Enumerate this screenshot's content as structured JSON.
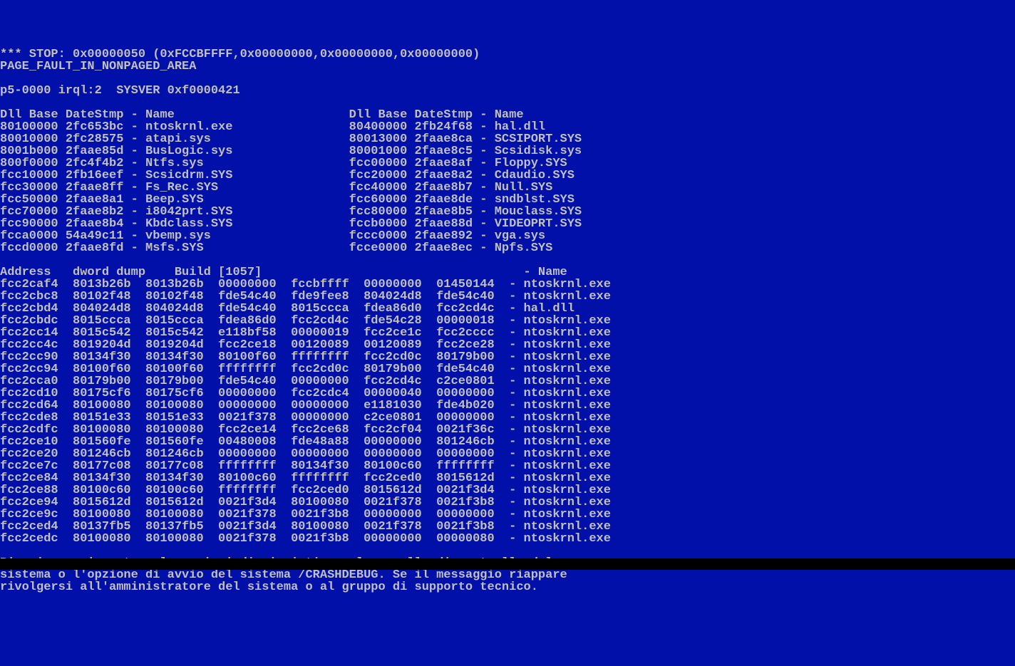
{
  "stop_line": "*** STOP: 0x00000050 (0xFCCBFFFF,0x00000000,0x00000000,0x00000000)",
  "fault_name": "PAGE_FAULT_IN_NONPAGED_AREA",
  "sysver_line": "p5-0000 irql:2  SYSVER 0xf0000421",
  "dll_header": "Dll Base DateStmp - Name                        Dll Base DateStmp - Name",
  "dll_rows": [
    {
      "la": "80100000",
      "ld": "2fc653bc",
      "ln": "ntoskrnl.exe",
      "ra": "80400000",
      "rd": "2fb24f68",
      "rn": "hal.dll"
    },
    {
      "la": "80010000",
      "ld": "2fc28575",
      "ln": "atapi.sys",
      "ra": "80013000",
      "rd": "2faae8ca",
      "rn": "SCSIPORT.SYS"
    },
    {
      "la": "8001b000",
      "ld": "2faae85d",
      "ln": "BusLogic.sys",
      "ra": "80001000",
      "rd": "2faae8c5",
      "rn": "Scsidisk.sys"
    },
    {
      "la": "800f0000",
      "ld": "2fc4f4b2",
      "ln": "Ntfs.sys",
      "ra": "fcc00000",
      "rd": "2faae8af",
      "rn": "Floppy.SYS"
    },
    {
      "la": "fcc10000",
      "ld": "2fb16eef",
      "ln": "Scsicdrm.SYS",
      "ra": "fcc20000",
      "rd": "2faae8a2",
      "rn": "Cdaudio.SYS"
    },
    {
      "la": "fcc30000",
      "ld": "2faae8ff",
      "ln": "Fs_Rec.SYS",
      "ra": "fcc40000",
      "rd": "2faae8b7",
      "rn": "Null.SYS"
    },
    {
      "la": "fcc50000",
      "ld": "2faae8a1",
      "ln": "Beep.SYS",
      "ra": "fcc60000",
      "rd": "2faae8de",
      "rn": "sndblst.SYS"
    },
    {
      "la": "fcc70000",
      "ld": "2faae8b2",
      "ln": "i8042prt.SYS",
      "ra": "fcc80000",
      "rd": "2faae8b5",
      "rn": "Mouclass.SYS"
    },
    {
      "la": "fcc90000",
      "ld": "2faae8b4",
      "ln": "Kbdclass.SYS",
      "ra": "fccb0000",
      "rd": "2faae88d",
      "rn": "VIDEOPRT.SYS"
    },
    {
      "la": "fcca0000",
      "ld": "54a49c11",
      "ln": "vbemp.sys",
      "ra": "fccc0000",
      "rd": "2faae892",
      "rn": "vga.sys"
    },
    {
      "la": "fccd0000",
      "ld": "2faae8fd",
      "ln": "Msfs.SYS",
      "ra": "fcce0000",
      "rd": "2faae8ec",
      "rn": "Npfs.SYS"
    }
  ],
  "dump_header": "Address   dword dump    Build [1057]                                    - Name",
  "dump_rows": [
    {
      "a": "fcc2caf4",
      "d": [
        "8013b26b",
        "8013b26b",
        "00000000",
        "fccbffff",
        "00000000",
        "01450144"
      ],
      "n": "ntoskrnl.exe"
    },
    {
      "a": "fcc2cbc8",
      "d": [
        "80102f48",
        "80102f48",
        "fde54c40",
        "fde9fee8",
        "804024d8",
        "fde54c40"
      ],
      "n": "ntoskrnl.exe"
    },
    {
      "a": "fcc2cbd4",
      "d": [
        "804024d8",
        "804024d8",
        "fde54c40",
        "8015ccca",
        "fdea86d0",
        "fcc2cd4c"
      ],
      "n": "hal.dll"
    },
    {
      "a": "fcc2cbdc",
      "d": [
        "8015ccca",
        "8015ccca",
        "fdea86d0",
        "fcc2cd4c",
        "fde54c28",
        "00000018"
      ],
      "n": "ntoskrnl.exe"
    },
    {
      "a": "fcc2cc14",
      "d": [
        "8015c542",
        "8015c542",
        "e118bf58",
        "00000019",
        "fcc2ce1c",
        "fcc2cccc"
      ],
      "n": "ntoskrnl.exe"
    },
    {
      "a": "fcc2cc4c",
      "d": [
        "8019204d",
        "8019204d",
        "fcc2ce18",
        "00120089",
        "00120089",
        "fcc2ce28"
      ],
      "n": "ntoskrnl.exe"
    },
    {
      "a": "fcc2cc90",
      "d": [
        "80134f30",
        "80134f30",
        "80100f60",
        "ffffffff",
        "fcc2cd0c",
        "80179b00"
      ],
      "n": "ntoskrnl.exe"
    },
    {
      "a": "fcc2cc94",
      "d": [
        "80100f60",
        "80100f60",
        "ffffffff",
        "fcc2cd0c",
        "80179b00",
        "fde54c40"
      ],
      "n": "ntoskrnl.exe"
    },
    {
      "a": "fcc2cca0",
      "d": [
        "80179b00",
        "80179b00",
        "fde54c40",
        "00000000",
        "fcc2cd4c",
        "c2ce0801"
      ],
      "n": "ntoskrnl.exe"
    },
    {
      "a": "fcc2cd10",
      "d": [
        "80175cf6",
        "80175cf6",
        "00000000",
        "fcc2cdc4",
        "00000040",
        "00000000"
      ],
      "n": "ntoskrnl.exe"
    },
    {
      "a": "fcc2cd64",
      "d": [
        "80100080",
        "80100080",
        "00000000",
        "00000000",
        "e1181030",
        "fde4b020"
      ],
      "n": "ntoskrnl.exe"
    },
    {
      "a": "fcc2cde8",
      "d": [
        "80151e33",
        "80151e33",
        "0021f378",
        "00000000",
        "c2ce0801",
        "00000000"
      ],
      "n": "ntoskrnl.exe"
    },
    {
      "a": "fcc2cdfc",
      "d": [
        "80100080",
        "80100080",
        "fcc2ce14",
        "fcc2ce68",
        "fcc2cf04",
        "0021f36c"
      ],
      "n": "ntoskrnl.exe"
    },
    {
      "a": "fcc2ce10",
      "d": [
        "801560fe",
        "801560fe",
        "00480008",
        "fde48a88",
        "00000000",
        "801246cb"
      ],
      "n": "ntoskrnl.exe"
    },
    {
      "a": "fcc2ce20",
      "d": [
        "801246cb",
        "801246cb",
        "00000000",
        "00000000",
        "00000000",
        "00000000"
      ],
      "n": "ntoskrnl.exe"
    },
    {
      "a": "fcc2ce7c",
      "d": [
        "80177c08",
        "80177c08",
        "ffffffff",
        "80134f30",
        "80100c60",
        "ffffffff"
      ],
      "n": "ntoskrnl.exe"
    },
    {
      "a": "fcc2ce84",
      "d": [
        "80134f30",
        "80134f30",
        "80100c60",
        "ffffffff",
        "fcc2ced0",
        "8015612d"
      ],
      "n": "ntoskrnl.exe"
    },
    {
      "a": "fcc2ce88",
      "d": [
        "80100c60",
        "80100c60",
        "ffffffff",
        "fcc2ced0",
        "8015612d",
        "0021f3d4"
      ],
      "n": "ntoskrnl.exe"
    },
    {
      "a": "fcc2ce94",
      "d": [
        "8015612d",
        "8015612d",
        "0021f3d4",
        "80100080",
        "0021f378",
        "0021f3b8"
      ],
      "n": "ntoskrnl.exe"
    },
    {
      "a": "fcc2ce9c",
      "d": [
        "80100080",
        "80100080",
        "0021f378",
        "0021f3b8",
        "00000000",
        "00000000"
      ],
      "n": "ntoskrnl.exe"
    },
    {
      "a": "fcc2ced4",
      "d": [
        "80137fb5",
        "80137fb5",
        "0021f3d4",
        "80100080",
        "0021f378",
        "0021f3b8"
      ],
      "n": "ntoskrnl.exe"
    },
    {
      "a": "fcc2cedc",
      "d": [
        "80100080",
        "80100080",
        "0021f378",
        "0021f3b8",
        "00000000",
        "00000080"
      ],
      "n": "ntoskrnl.exe"
    }
  ],
  "footer_lines": [
    "Riavviare e impostare le opzioni di ripristino nel pannello di controllo del",
    "sistema o l'opzione di avvio del sistema /CRASHDEBUG. Se il messaggio riappare",
    "rivolgersi all'amministratore del sistema o al gruppo di supporto tecnico."
  ]
}
